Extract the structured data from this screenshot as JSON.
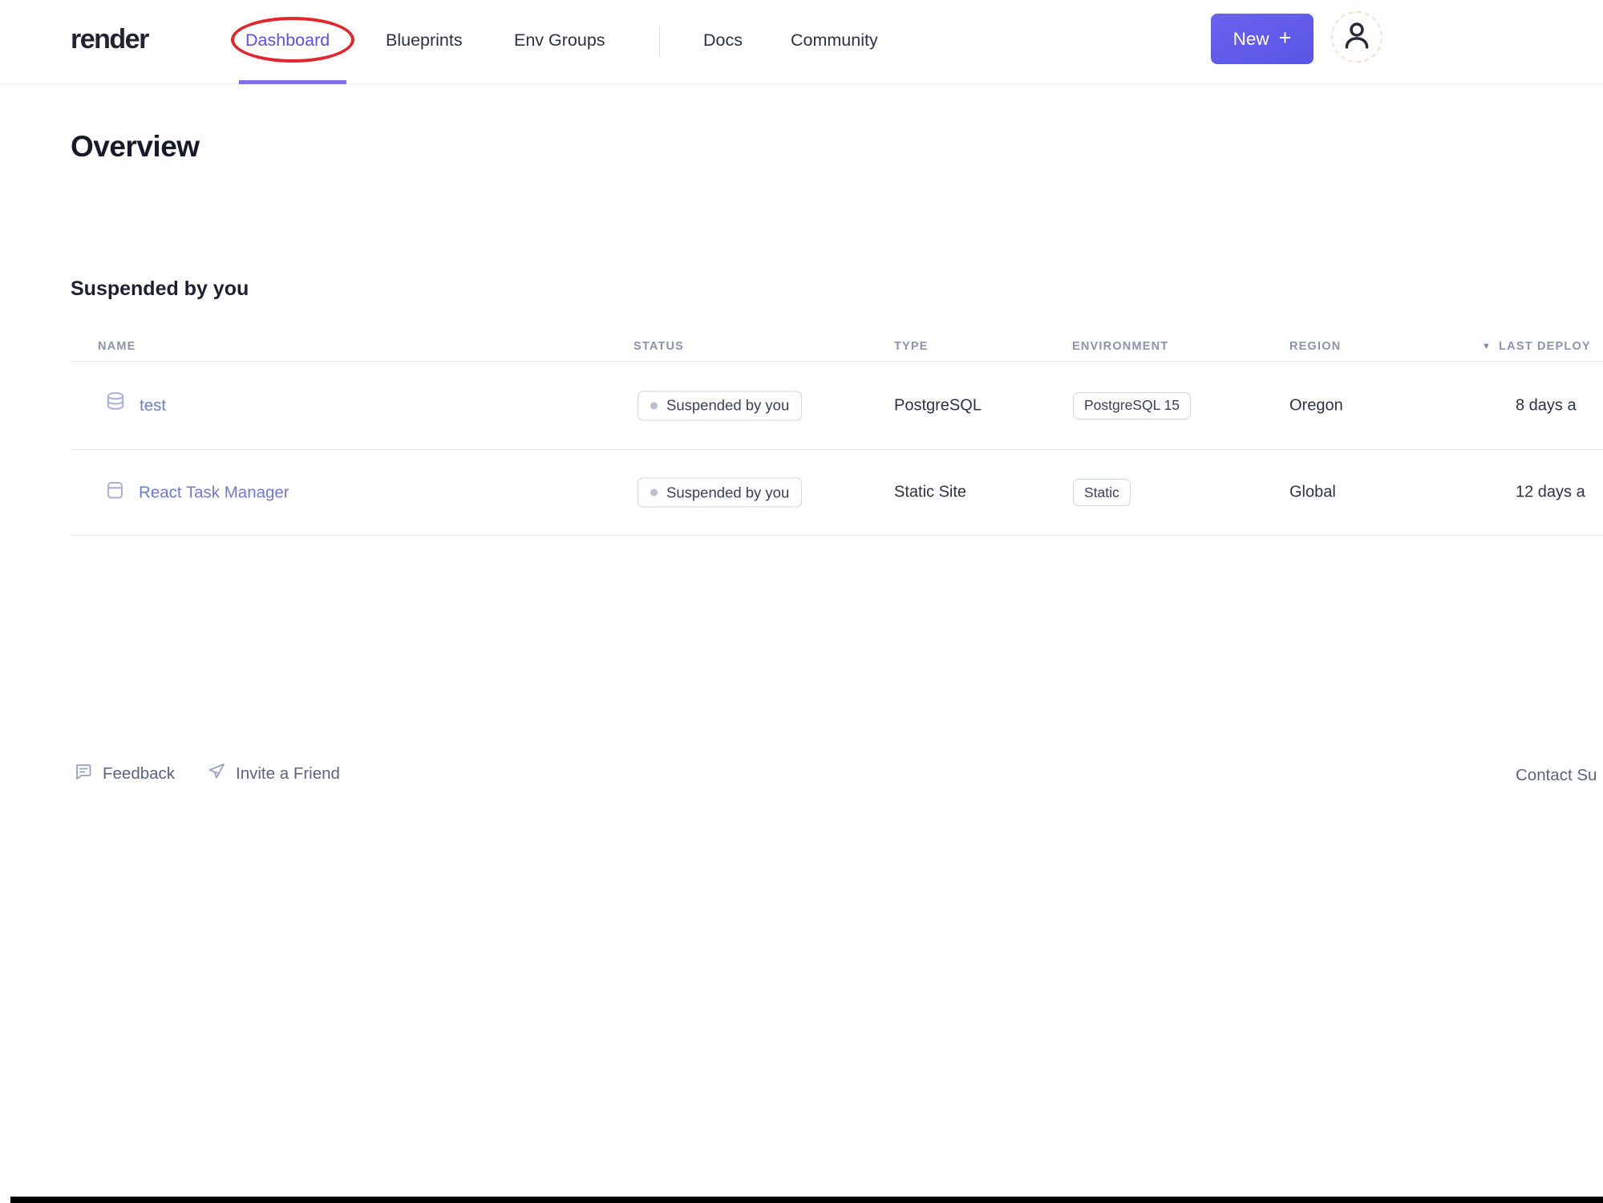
{
  "header": {
    "logo": "render",
    "nav": {
      "dashboard": "Dashboard",
      "blueprints": "Blueprints",
      "env_groups": "Env Groups",
      "docs": "Docs",
      "community": "Community"
    },
    "new_button": {
      "label": "New",
      "plus": "+"
    }
  },
  "page": {
    "title": "Overview"
  },
  "section": {
    "title": "Suspended by you"
  },
  "table": {
    "columns": {
      "name": "NAME",
      "status": "STATUS",
      "type": "TYPE",
      "environment": "ENVIRONMENT",
      "region": "REGION",
      "last_deploy": "LAST DEPLOY"
    },
    "sort_icon": "▼",
    "rows": [
      {
        "icon": "database",
        "name": "test",
        "status": "Suspended by you",
        "type": "PostgreSQL",
        "environment": "PostgreSQL 15",
        "region": "Oregon",
        "last_deploy": "8 days a"
      },
      {
        "icon": "static-site",
        "name": "React Task Manager",
        "status": "Suspended by you",
        "type": "Static Site",
        "environment": "Static",
        "region": "Global",
        "last_deploy": "12 days a"
      }
    ]
  },
  "footer": {
    "feedback": "Feedback",
    "invite": "Invite a Friend",
    "contact": "Contact Su"
  },
  "annotation": {
    "shape": "ellipse",
    "target": "Dashboard",
    "color": "#e2262b"
  },
  "colors": {
    "accent_purple": "#5a4ff0",
    "active_underline": "#7b70f2",
    "link_blue": "#6b7bd9",
    "badge_border": "#ccd6ea",
    "status_dot": "#b5bfd6",
    "new_button": "#5f58e8",
    "annotation_red": "#e2262b"
  }
}
